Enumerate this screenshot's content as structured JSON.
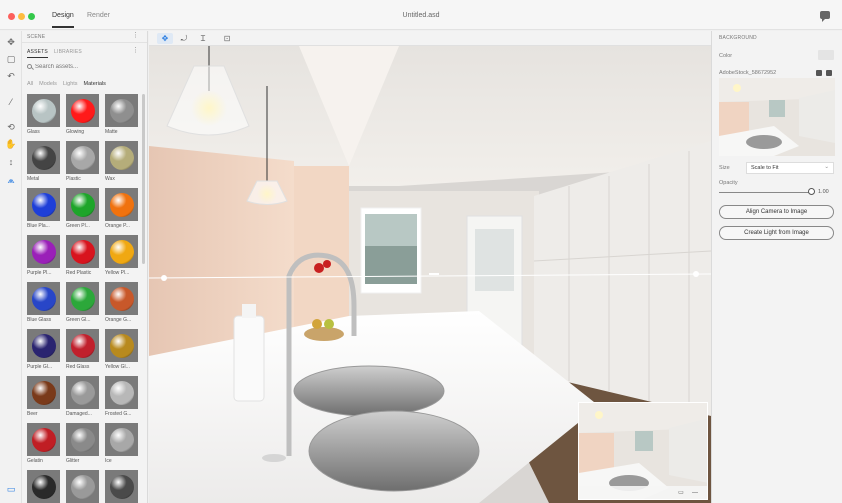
{
  "app": {
    "modes": [
      "Design",
      "Render"
    ],
    "document_title": "Untitled.asd"
  },
  "tools": [
    "select-icon",
    "rectangle-icon",
    "undo-icon",
    "magic-wand-icon",
    "orbit-icon",
    "pan-hand-icon",
    "dolly-icon",
    "horizon-icon",
    "panel-toggle-icon"
  ],
  "scene": {
    "label": "SCENE",
    "tabs": [
      "ASSETS",
      "LIBRARIES"
    ],
    "search_placeholder": "Search assets...",
    "filters": [
      "All",
      "Models",
      "Lights",
      "Materials"
    ],
    "materials": [
      {
        "label": "Glass",
        "color": "#b8c4c4"
      },
      {
        "label": "Glowing",
        "color": "#ff1a1a"
      },
      {
        "label": "Matte",
        "color": "#8f8f8f"
      },
      {
        "label": "Metal",
        "color": "#444444"
      },
      {
        "label": "Plastic",
        "color": "#a8a8a8"
      },
      {
        "label": "Wax",
        "color": "#b5ad7a"
      },
      {
        "label": "Blue Pla...",
        "color": "#1e3fd8"
      },
      {
        "label": "Green Pl...",
        "color": "#1ea52a"
      },
      {
        "label": "Orange P...",
        "color": "#f0720e"
      },
      {
        "label": "Purple Pl...",
        "color": "#9a20b8"
      },
      {
        "label": "Red Plastic",
        "color": "#d8141e"
      },
      {
        "label": "Yellow Pl...",
        "color": "#f0a812"
      },
      {
        "label": "Blue Glass",
        "color": "#2846c8"
      },
      {
        "label": "Green Gl...",
        "color": "#2ca83a"
      },
      {
        "label": "Orange G...",
        "color": "#c8582a"
      },
      {
        "label": "Purple Gl...",
        "color": "#2a2470"
      },
      {
        "label": "Red Glass",
        "color": "#c0202c"
      },
      {
        "label": "Yellow Gl...",
        "color": "#b88a1e"
      },
      {
        "label": "Beer",
        "color": "#7a3a1a"
      },
      {
        "label": "Damaged...",
        "color": "#9a9a9a"
      },
      {
        "label": "Frosted G...",
        "color": "#b8b8b8"
      },
      {
        "label": "Gelatin",
        "color": "#c01e24"
      },
      {
        "label": "Glitter",
        "color": "#8a8a8a"
      },
      {
        "label": "Ice",
        "color": "#a8a8a8"
      },
      {
        "label": "",
        "color": "#2a2a2a"
      },
      {
        "label": "",
        "color": "#9a9a9a"
      },
      {
        "label": "",
        "color": "#4a4a4a"
      }
    ]
  },
  "canvas_tools": [
    "move-icon",
    "rotate-icon",
    "scale-icon",
    "fit-icon"
  ],
  "properties": {
    "section": "BACKGROUND",
    "color_label": "Color",
    "image_name": "AdobeStock_58672952",
    "size_label": "Size",
    "size_value": "Scale to Fit",
    "opacity_label": "Opacity",
    "opacity_value": "1.00",
    "opacity_fraction": 1.0,
    "align_button": "Align Camera to Image",
    "light_button": "Create Light from Image"
  },
  "colors": {
    "accent": "#2a7de1",
    "panel": "#f3f3f3"
  }
}
